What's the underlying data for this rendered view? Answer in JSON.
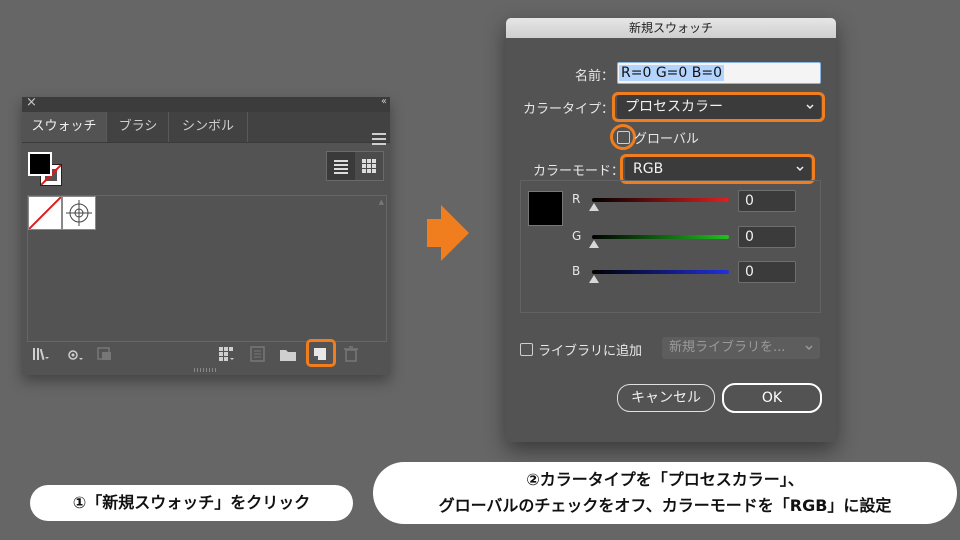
{
  "swatches_panel": {
    "tabs": [
      "スウォッチ",
      "ブラシ",
      "シンボル"
    ],
    "active_tab": 0,
    "close_icon": "×",
    "collapse_icon": "‹‹",
    "swatches": [
      "none-swatch",
      "registration-swatch"
    ],
    "bottom_icons": [
      "swatch-libraries-icon",
      "show-swatch-kinds-icon",
      "swatch-options-icon",
      "color-group-icon",
      "edit-color-group-icon",
      "new-color-group-icon",
      "new-swatch-icon",
      "delete-swatch-icon"
    ]
  },
  "dialog": {
    "title": "新規スウォッチ",
    "name_label": "名前：",
    "name_value": "R=0 G=0 B=0",
    "color_type_label": "カラータイプ：",
    "color_type_value": "プロセスカラー",
    "global_label": "グローバル",
    "global_checked": false,
    "color_mode_label": "カラーモード：",
    "color_mode_value": "RGB",
    "channels": [
      {
        "label": "R",
        "value": "0",
        "color": "#e02020"
      },
      {
        "label": "G",
        "value": "0",
        "color": "#20c020"
      },
      {
        "label": "B",
        "value": "0",
        "color": "#2030e0"
      }
    ],
    "add_to_library_label": "ライブラリに追加",
    "library_placeholder": "新規ライブラリを...",
    "cancel_label": "キャンセル",
    "ok_label": "OK"
  },
  "captions": {
    "step1": "①「新規スウォッチ」をクリック",
    "step2_line1": "②カラータイプを「プロセスカラー」、",
    "step2_line2": "グローバルのチェックをオフ、カラーモードを「RGB」に設定"
  },
  "colors": {
    "highlight": "#f07d1e",
    "arrow": "#f07d1e",
    "background": "#666666"
  }
}
